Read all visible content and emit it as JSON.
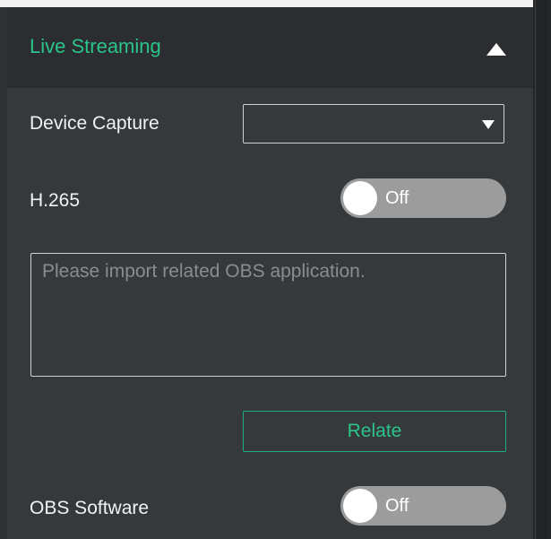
{
  "panel": {
    "title": "Live Streaming",
    "collapse_icon": "triangle-up-icon"
  },
  "device_capture": {
    "label": "Device Capture",
    "selected_value": "",
    "caret_icon": "triangle-down-icon"
  },
  "h265": {
    "label": "H.265",
    "state": "Off"
  },
  "obs_path": {
    "placeholder": "Please import related OBS application."
  },
  "relate_button": {
    "label": "Relate"
  },
  "obs_software": {
    "label": "OBS Software",
    "state": "Off"
  },
  "colors": {
    "accent": "#2bc48a",
    "panel_bg": "#35393c",
    "header_bg": "#2b2d30",
    "toggle_off": "#9c9c9c"
  }
}
